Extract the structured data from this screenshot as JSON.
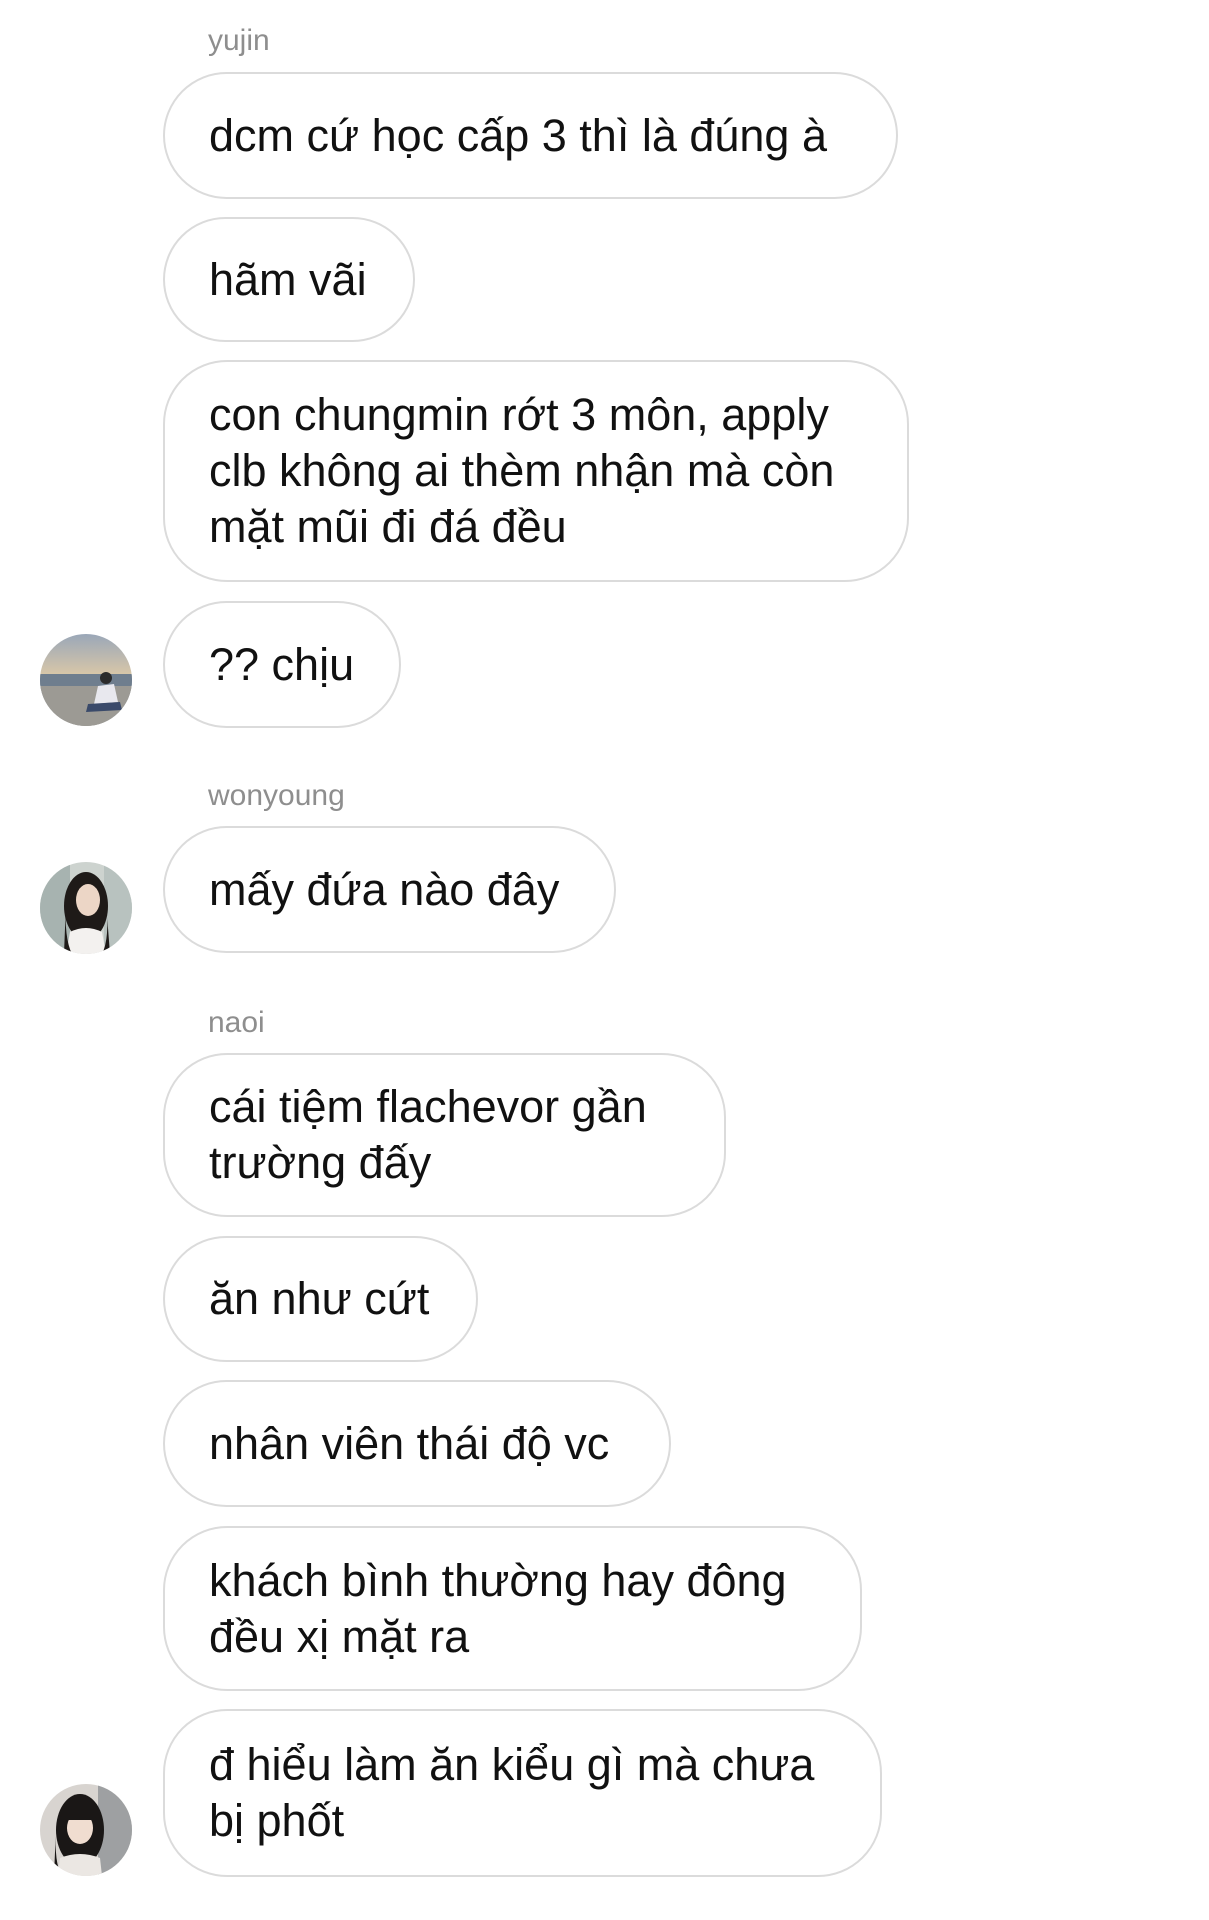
{
  "conversation": {
    "groups": [
      {
        "sender": "yujin",
        "messages": [
          "dcm cứ học cấp 3 thì là đúng à",
          "hãm vãi",
          "con chungmin rớt 3 môn, apply\nclb không ai thèm nhận mà còn\nmặt mũi đi đá đều",
          "?? chịu"
        ],
        "avatar_icon": "avatar-photo-seaside"
      },
      {
        "sender": "wonyoung",
        "messages": [
          "mấy đứa nào đây"
        ],
        "avatar_icon": "avatar-photo-girl-dark-hair"
      },
      {
        "sender": "naoi",
        "messages": [
          "cái tiệm flachevor gần\ntrường đấy",
          "ăn như cứt",
          "nhân viên thái độ vc",
          "khách bình thường hay đông\nđều xị mặt ra",
          "đ hiểu làm ăn kiểu gì mà chưa\nbị phốt"
        ],
        "avatar_icon": "avatar-photo-girl-bangs"
      }
    ]
  },
  "colors": {
    "bubble_border": "#dbdbdb",
    "sender_text": "#8e8e8e",
    "message_text": "#111111",
    "background": "#ffffff"
  }
}
